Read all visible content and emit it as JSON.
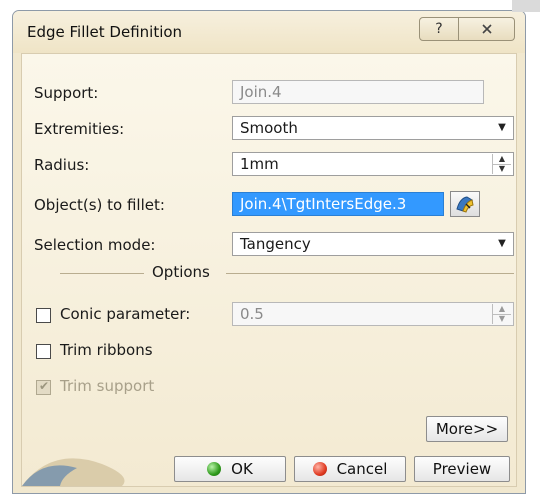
{
  "window": {
    "title": "Edge Fillet Definition",
    "help_glyph": "?",
    "close_glyph": "X"
  },
  "form": {
    "support": {
      "label": "Support:",
      "value": "Join.4"
    },
    "extremities": {
      "label": "Extremities:",
      "value": "Smooth"
    },
    "radius": {
      "label": "Radius:",
      "value": "1mm"
    },
    "objects": {
      "label": "Object(s) to fillet:",
      "value": "Join.4\\TgtIntersEdge.3"
    },
    "selection_mode": {
      "label": "Selection mode:",
      "value": "Tangency"
    }
  },
  "options": {
    "header": "Options",
    "conic": {
      "label": "Conic parameter:",
      "value": "0.5",
      "checked": false
    },
    "trim_ribbons": {
      "label": "Trim ribbons",
      "checked": false
    },
    "trim_support": {
      "label": "Trim support",
      "checked": true,
      "enabled": false
    }
  },
  "buttons": {
    "more": "More>>",
    "ok": "OK",
    "cancel": "Cancel",
    "preview": "Preview"
  },
  "colors": {
    "dialog_bg": "#f1e8cf",
    "selection_bg": "#3399ff",
    "ok_indicator": "#2e9a1b",
    "cancel_indicator": "#e03b22"
  },
  "icons": {
    "dropdown": "chevron-down-icon",
    "spinner": "spin-arrows-icon",
    "edge_picker": "edge-picker-icon"
  }
}
